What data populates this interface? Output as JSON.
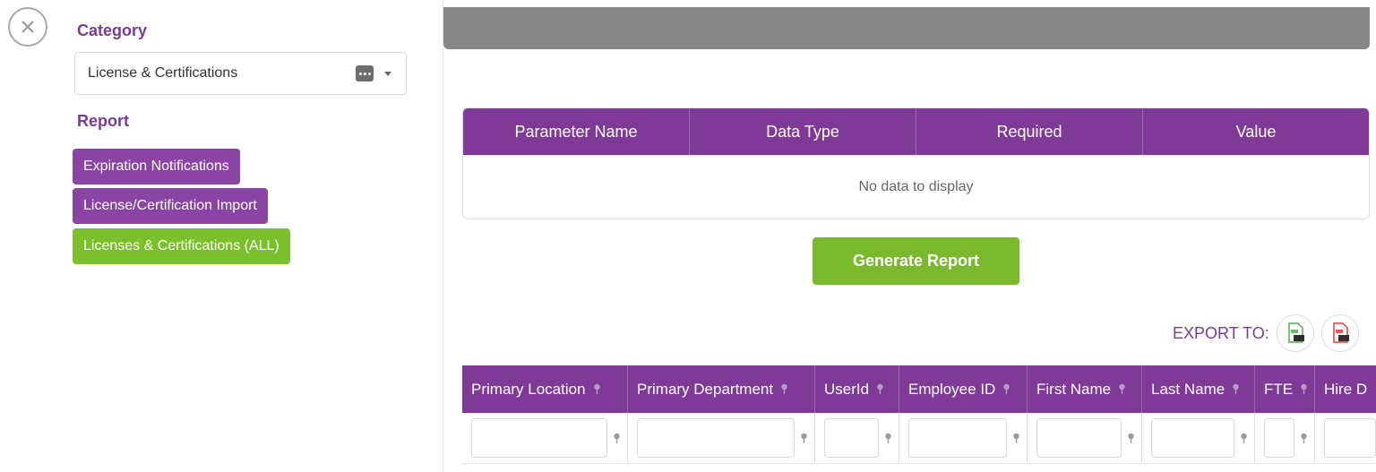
{
  "sidebar": {
    "category_label": "Category",
    "category_value": "License & Certifications",
    "report_label": "Report",
    "reports": [
      {
        "label": "Expiration Notifications",
        "state": "default"
      },
      {
        "label": "License/Certification Import",
        "state": "default"
      },
      {
        "label": "Licenses & Certifications (ALL)",
        "state": "selected"
      }
    ]
  },
  "parameters": {
    "columns": [
      "Parameter Name",
      "Data Type",
      "Required",
      "Value"
    ],
    "empty_text": "No data to display"
  },
  "generate_label": "Generate Report",
  "export": {
    "label": "EXPORT TO:",
    "formats": [
      "XLS",
      "PDF"
    ]
  },
  "grid": {
    "columns": [
      "Primary Location",
      "Primary Department",
      "UserId",
      "Employee ID",
      "First Name",
      "Last Name",
      "FTE",
      "Hire D"
    ]
  },
  "colors": {
    "accent_purple": "#7f3a97",
    "report_green": "#7bc02c",
    "header_bar_gray": "#878787"
  }
}
